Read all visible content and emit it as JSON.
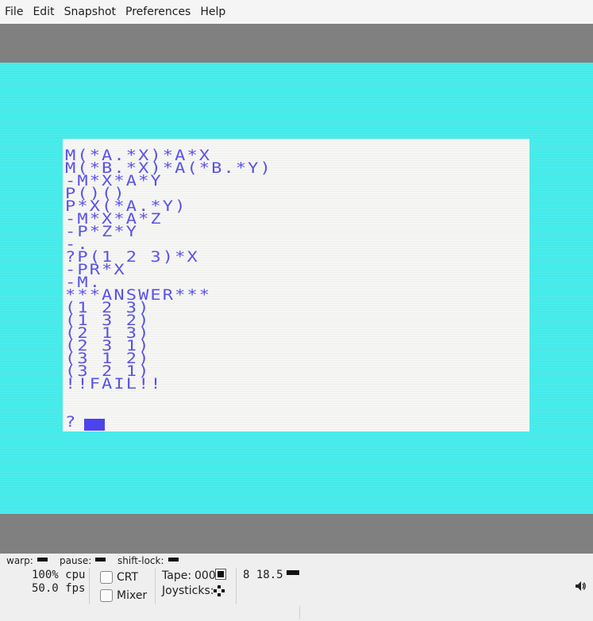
{
  "menubar": {
    "items": [
      "File",
      "Edit",
      "Snapshot",
      "Preferences",
      "Help"
    ]
  },
  "screen": {
    "border_color": "#45eaea",
    "paper_color": "#f6f6f4",
    "ink_color": "#5a52e8",
    "lines": [
      "M(*A.*X)*A*X",
      "M(*B.*X)*A(*B.*Y)",
      "-M*X*A*Y",
      "P()()",
      "P*X(*A.*Y)",
      "-M*X*A*Z",
      "-P*Z*Y",
      "-.",
      "?P(1 2 3)*X",
      "-PR*X",
      "-M.",
      "***ANSWER***",
      "(1 2 3)",
      "(1 3 2)",
      "(2 1 3)",
      "(2 3 1)",
      "(3 1 2)",
      "(3 2 1)",
      "!!FAIL!!",
      "",
      "?"
    ]
  },
  "status": {
    "warp_label": "warp:",
    "pause_label": "pause:",
    "shift_lock_label": "shift-lock:",
    "cpu": "100% cpu",
    "fps": "50.0 fps",
    "crt_label": "CRT",
    "mixer_label": "Mixer",
    "tape_label": "Tape:",
    "tape_counter": "000",
    "joysticks_label": "Joysticks:",
    "drive_info": "8 18.5",
    "volume_icon": "speaker-icon"
  }
}
